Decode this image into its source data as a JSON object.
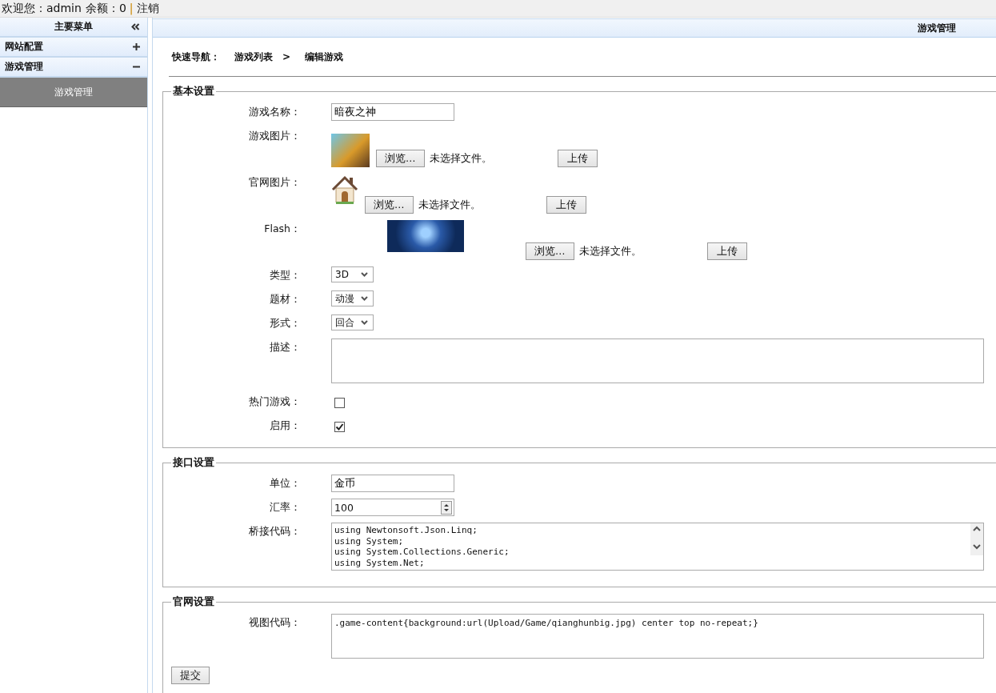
{
  "topbar": {
    "welcome": "欢迎您：admin",
    "balance": "余额：0",
    "separator": "|",
    "logout": "注销"
  },
  "sidebar": {
    "title": "主要菜单",
    "items": [
      {
        "label": "网站配置",
        "expanded": false
      },
      {
        "label": "游戏管理",
        "expanded": true,
        "children": [
          {
            "label": "游戏管理",
            "selected": true
          }
        ]
      }
    ]
  },
  "header": {
    "title": "游戏管理"
  },
  "breadcrumb": {
    "label": "快速导航：",
    "items": [
      "游戏列表",
      "编辑游戏"
    ],
    "separator": ">"
  },
  "sections": [
    {
      "legend": "基本设置",
      "fields": [
        {
          "kind": "text",
          "label": "游戏名称：",
          "value": "暗夜之神"
        },
        {
          "kind": "photo_upload",
          "label": "游戏图片：",
          "browse": "浏览…",
          "status": "未选择文件。",
          "upload": "上传"
        },
        {
          "kind": "icon_upload",
          "label": "官网图片：",
          "browse": "浏览…",
          "status": "未选择文件。",
          "upload": "上传"
        },
        {
          "kind": "banner_upload",
          "label": "Flash：",
          "browse": "浏览…",
          "status": "未选择文件。",
          "upload": "上传"
        },
        {
          "kind": "select",
          "label": "类型：",
          "value": "3D"
        },
        {
          "kind": "select",
          "label": "题材：",
          "value": "动漫"
        },
        {
          "kind": "select",
          "label": "形式：",
          "value": "回合"
        },
        {
          "kind": "textarea",
          "label": "描述："
        },
        {
          "kind": "checkbox",
          "label": "热门游戏：",
          "checked": false
        },
        {
          "kind": "checkbox",
          "label": "启用：",
          "checked": true
        }
      ]
    },
    {
      "legend": "接口设置",
      "fields": [
        {
          "kind": "text",
          "label": "单位：",
          "value": "金币"
        },
        {
          "kind": "number",
          "label": "汇率：",
          "value": "100"
        },
        {
          "kind": "code",
          "label": "桥接代码：",
          "lines": [
            "using Newtonsoft.Json.Linq;",
            "using System;",
            "using System.Collections.Generic;",
            "using System.Net;"
          ]
        }
      ]
    },
    {
      "legend": "官网设置",
      "fields": [
        {
          "kind": "textarea",
          "label": "视图代码：",
          "value": ".game-content{background:url(Upload/Game/qianghunbig.jpg) center top no-repeat;}"
        }
      ],
      "submit": "提交"
    }
  ]
}
